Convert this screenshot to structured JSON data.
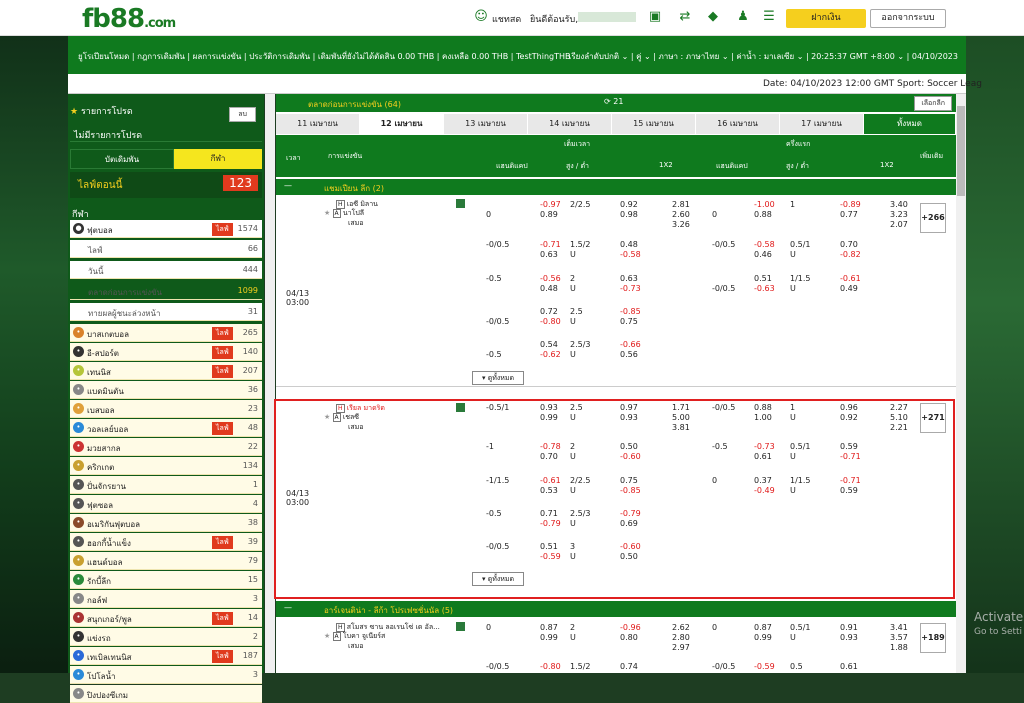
{
  "brand": {
    "logo": "fb88",
    "logo_suffix": ".com"
  },
  "topbar": {
    "chat": "แชทสด",
    "welcome": "ยินดีต้อนรับ,",
    "deposit": "ฝากเงิน",
    "logout": "ออกจากระบบ"
  },
  "nav": {
    "left": "ยูโรเปียนโหมด | กฎการเดิมพัน | ผลการแข่งขัน | ประวัติการเดิมพัน | เดิมพันที่ยังไม่ได้ตัดสิน 0.00 THB | คงเหลือ 0.00 THB | TestThingTHB",
    "right": "เรียงลำดับปกติ ⌄ | คู่ ⌄ | ภาษา : ภาษาไทย ⌄ | ค่าน้ำ : มาเลเซีย ⌄ | 20:25:37 GMT +8:00 ⌄ | 04/10/2023"
  },
  "infobar": "Date: 04/10/2023 12:00 GMT Sport: Soccer Leag",
  "sidebar": {
    "fav_title": "รายการโปรด",
    "fav_edit": "ลบ",
    "no_fav": "ไม่มีรายการโปรด",
    "tab_bet": "บัตเดิมพัน",
    "tab_sport": "กีฬา",
    "live_label": "ไลฟ์ตอนนี้",
    "live_count": "123",
    "sports_title": "กีฬา",
    "soccer": {
      "name": "ฟุตบอล",
      "live": "ไลฟ์",
      "count": "1574"
    },
    "subs": [
      {
        "name": "ไลฟ์",
        "count": "66"
      },
      {
        "name": "วันนี้",
        "count": "444"
      },
      {
        "name": "ตลาดก่อนการแข่งขัน",
        "count": "1099"
      },
      {
        "name": "ทายผลผู้ชนะล่วงหน้า",
        "count": "31"
      }
    ],
    "sports": [
      {
        "name": "บาสเกตบอล",
        "live": "ไลฟ์",
        "count": "265"
      },
      {
        "name": "อี-สปอร์ต",
        "live": "ไลฟ์",
        "count": "140"
      },
      {
        "name": "เทนนิส",
        "live": "ไลฟ์",
        "count": "207"
      },
      {
        "name": "แบดมินตัน",
        "live": "",
        "count": "36"
      },
      {
        "name": "เบสบอล",
        "live": "",
        "count": "23"
      },
      {
        "name": "วอลเลย์บอล",
        "live": "ไลฟ์",
        "count": "48"
      },
      {
        "name": "มวยสากล",
        "live": "",
        "count": "22"
      },
      {
        "name": "คริกเกต",
        "live": "",
        "count": "134"
      },
      {
        "name": "ปั่นจักรยาน",
        "live": "",
        "count": "1"
      },
      {
        "name": "ฟุตซอล",
        "live": "",
        "count": "4"
      },
      {
        "name": "อเมริกันฟุตบอล",
        "live": "",
        "count": "38"
      },
      {
        "name": "ฮอกกี้น้ำแข็ง",
        "live": "ไลฟ์",
        "count": "39"
      },
      {
        "name": "แฮนด์บอล",
        "live": "",
        "count": "79"
      },
      {
        "name": "รักบี้ลีก",
        "live": "",
        "count": "15"
      },
      {
        "name": "กอล์ฟ",
        "live": "",
        "count": "3"
      },
      {
        "name": "สนุกเกอร์/พูล",
        "live": "ไลฟ์",
        "count": "14"
      },
      {
        "name": "แข่งรถ",
        "live": "",
        "count": "2"
      },
      {
        "name": "เทเบิลเทนนิส",
        "live": "ไลฟ์",
        "count": "187"
      },
      {
        "name": "โปโลน้ำ",
        "live": "",
        "count": "3"
      },
      {
        "name": "ปิงปองซีเกม",
        "live": "",
        "count": ""
      }
    ]
  },
  "main": {
    "header": "ตลาดก่อนการแข่งขัน (64)",
    "refresh": "21",
    "select_league": "เลือกลีก",
    "dates": [
      "11 เมษายน",
      "12 เมษายน",
      "13 เมษายน",
      "14 เมษายน",
      "15 เมษายน",
      "16 เมษายน",
      "17 เมษายน",
      "ทั้งหมด"
    ],
    "cols": {
      "time": "เวลา",
      "match": "การแข่งขัน",
      "full": "เต็มเวลา",
      "half": "ครึ่งแรก",
      "hdp": "แฮนดิแคป",
      "ou": "สูง / ต่ำ",
      "x12": "1X2",
      "more": "เพิ่มเติม"
    },
    "league1": "แชมเปียน ลีก (2)",
    "league2": "อาร์เจนติน่า - ลีก้า โปรเฟซชั่นนัล (5)",
    "expand": "ดูทั้งหมด",
    "m1": {
      "date": "04/13",
      "time": "03:00",
      "home": "เอซี มิลาน",
      "away": "นาโปลี",
      "draw": "เสมอ",
      "more": "+266"
    },
    "m2": {
      "date": "04/13",
      "time": "03:00",
      "home": "เรียล มาดริด",
      "away": "เชลซี",
      "draw": "เสมอ",
      "more": "+271"
    },
    "m3": {
      "home": "สโมสร ซาน ลอเรนโซ่ เด อัล...",
      "away": "โบคา จูเนียร์ส",
      "draw": "เสมอ",
      "more": "+189"
    }
  }
}
